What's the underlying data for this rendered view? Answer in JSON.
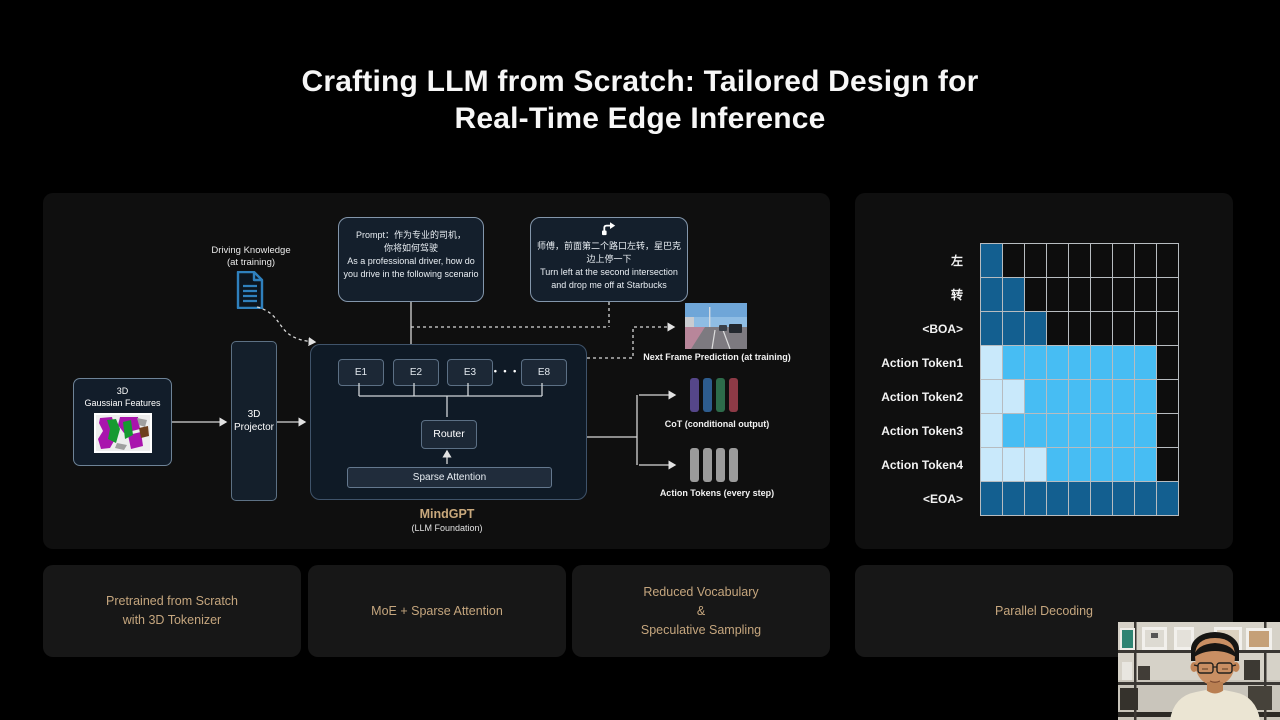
{
  "title": {
    "line1": "Crafting LLM from Scratch: Tailored Design for",
    "line2": "Real-Time Edge Inference"
  },
  "left_panel": {
    "driving_knowledge": {
      "line1": "Driving Knowledge",
      "line2": "(at training)"
    },
    "prompt_box_1": {
      "lines": [
        "Prompt：作为专业的司机，",
        "你将如何驾驶",
        "As a professional driver, how do",
        "you drive in the following scenario"
      ]
    },
    "prompt_box_2": {
      "lines": [
        "师傅，前面第二个路口左转，星巴克",
        "边上停一下",
        "Turn left at the second intersection",
        "and drop me off at Starbucks"
      ]
    },
    "gaussian_box": {
      "line1": "3D",
      "line2": "Gaussian Features"
    },
    "projector_box": {
      "line1": "3D",
      "line2": "Projector"
    },
    "moe": {
      "experts": [
        "E1",
        "E2",
        "E3",
        "E8"
      ],
      "dots": "• • •",
      "router": "Router",
      "sparse_attention": "Sparse Attention"
    },
    "mindgpt": {
      "name": "MindGPT",
      "sub": "(LLM Foundation)"
    },
    "next_frame_label": "Next Frame Prediction (at training)",
    "cot": {
      "label": "CoT (conditional output)",
      "bar_colors": [
        "#554689",
        "#2d5c8e",
        "#2d6b4a",
        "#8d3a46"
      ]
    },
    "action": {
      "label": "Action Tokens (every step)",
      "bar_color": "#9b9b9b"
    }
  },
  "chart_data": {
    "type": "heatmap",
    "rows": [
      "左",
      "转",
      "<BOA>",
      "Action Token1",
      "Action Token2",
      "Action Token3",
      "Action Token4",
      "<EOA>"
    ],
    "n_cols": 9,
    "cell_rows": [
      "D........",
      "DD.......",
      "DDD......",
      "PSSSSSSS.",
      "PPSSSSSS.",
      "PSSSSSSS.",
      "PPPSSSSS.",
      "DDDDDDDDD"
    ],
    "cell_colors": {
      "D": "#135f90",
      "S": "#47bdf3",
      "P": "#c9e9fb",
      ".": "#0d0d0d"
    },
    "grid_color": "#b7bcc0"
  },
  "cards": [
    {
      "lines": [
        "Pretrained from Scratch",
        "with 3D Tokenizer"
      ]
    },
    {
      "lines": [
        "MoE + Sparse Attention"
      ]
    },
    {
      "lines": [
        "Reduced Vocabulary",
        "&",
        "Speculative Sampling"
      ]
    },
    {
      "lines": [
        "Parallel Decoding"
      ]
    }
  ],
  "accent_color": "#c5a67e"
}
